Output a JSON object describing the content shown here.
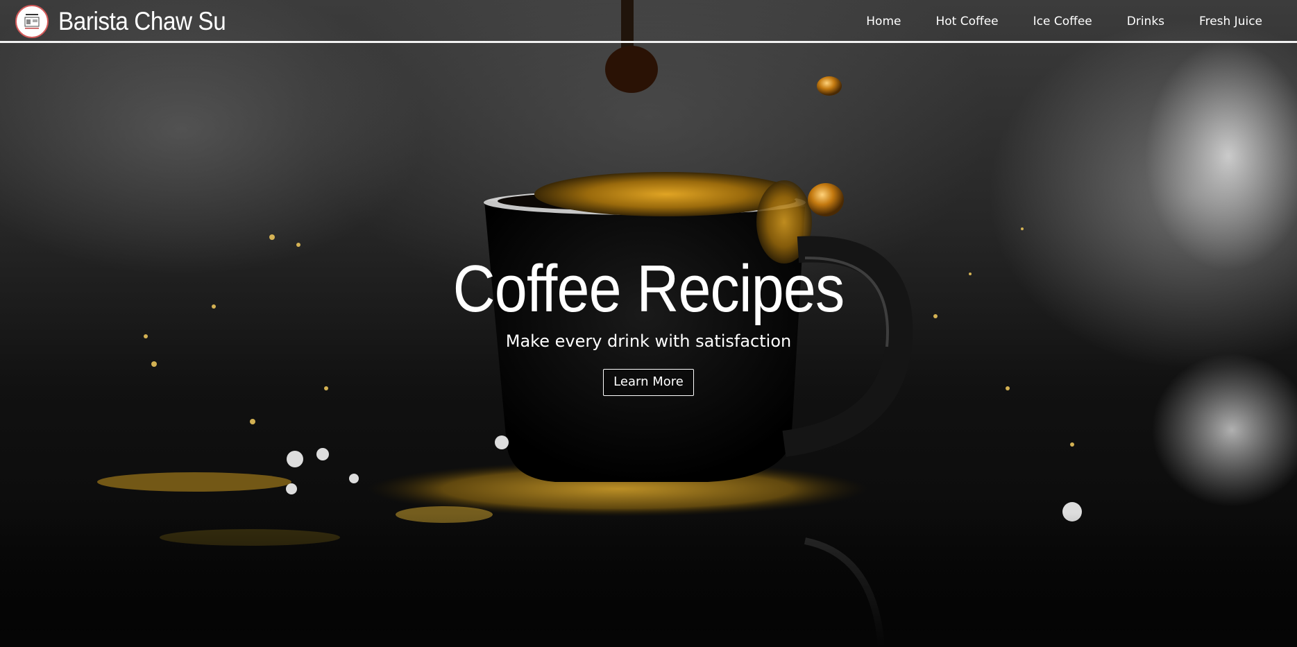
{
  "brand": {
    "name": "Barista Chaw Su",
    "logo_icon": "coffee-shop-logo-icon"
  },
  "nav": {
    "items": [
      {
        "label": "Home"
      },
      {
        "label": "Hot Coffee"
      },
      {
        "label": "Ice Coffee"
      },
      {
        "label": "Drinks"
      },
      {
        "label": "Fresh Juice"
      }
    ]
  },
  "hero": {
    "title": "Coffee Recipes",
    "subtitle": "Make every drink with satisfaction",
    "button_label": "Learn More",
    "background_image": "black-coffee-cup-splash-photo"
  },
  "colors": {
    "text": "#ffffff",
    "header_border": "#f2f2f2",
    "logo_ring": "#d35a5a",
    "coffee_gold": "#c98a12"
  }
}
